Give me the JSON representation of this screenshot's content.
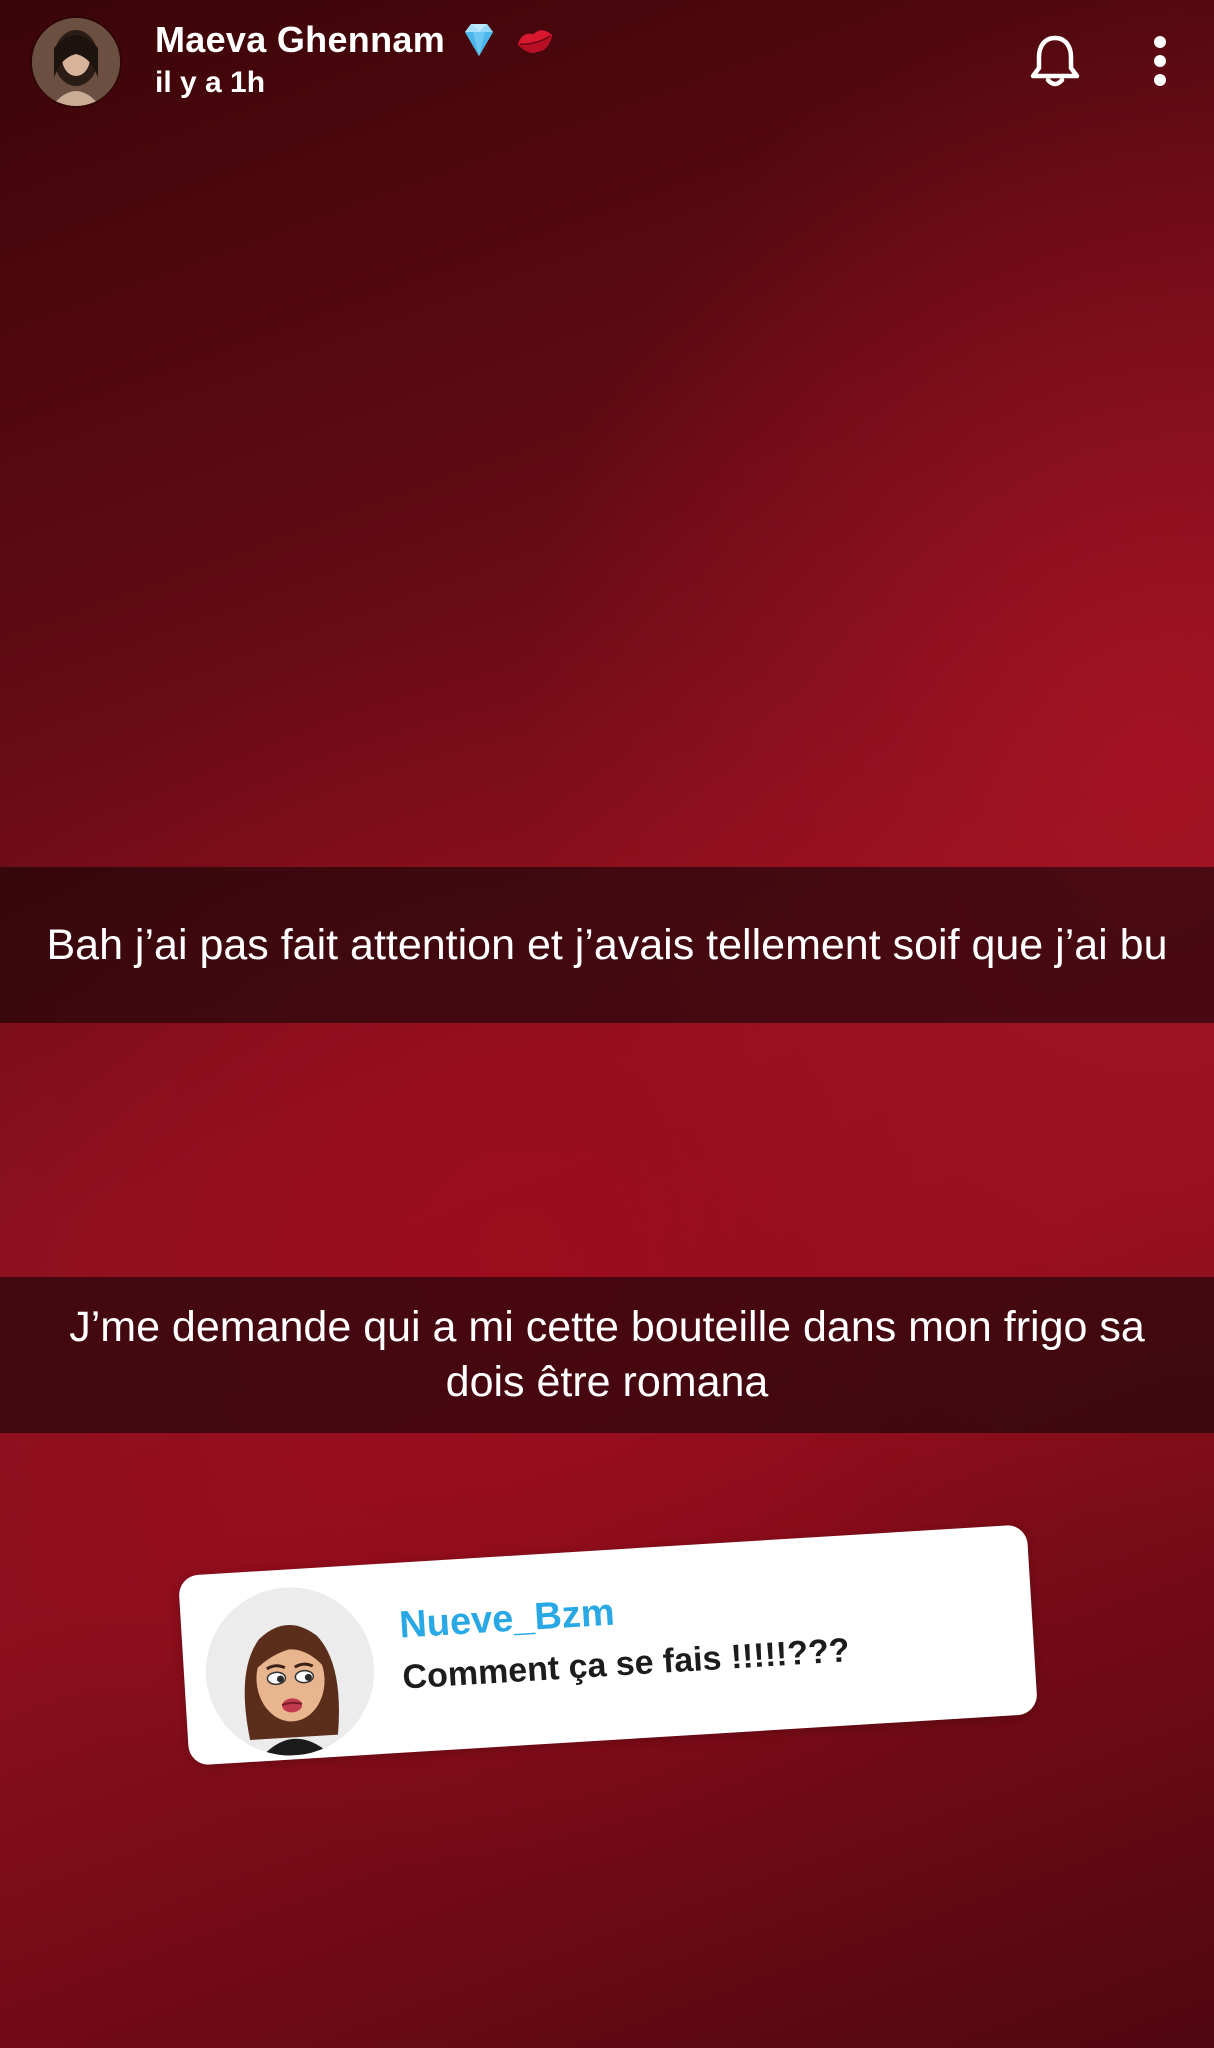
{
  "header": {
    "user_name": "Maeva Ghennam",
    "badges": [
      "diamond-icon",
      "kiss-lips-icon"
    ],
    "timestamp": "il y a 1h"
  },
  "captions": [
    {
      "text": "Bah j’ai pas fait attention et j’avais tellement soif que j’ai bu"
    },
    {
      "text": "J’me demande qui a mi cette bouteille dans mon frigo sa dois être romana"
    }
  ],
  "reply": {
    "username": "Nueve_Bzm",
    "message": "Comment ça se fais !!!!!???"
  },
  "colors": {
    "background": "#8a111e",
    "caption_bg": "#140508",
    "reply_username": "#29a8e6"
  }
}
